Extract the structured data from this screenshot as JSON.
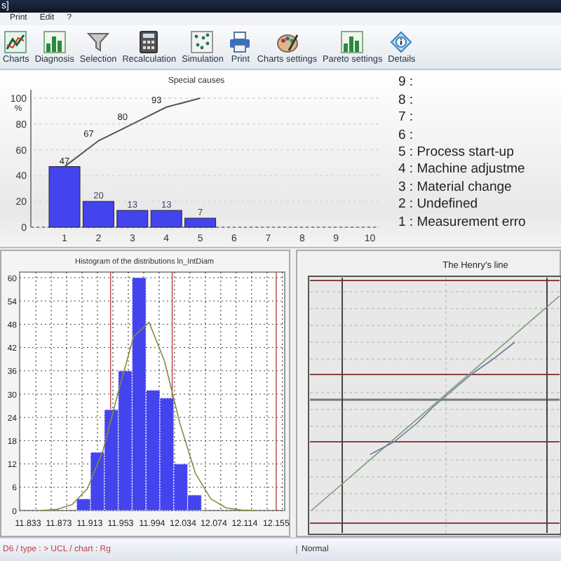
{
  "window": {
    "title": "s]"
  },
  "menu": [
    "Print",
    "Edit",
    "?"
  ],
  "toolbar": [
    {
      "label": "Charts",
      "kind": "charts"
    },
    {
      "label": "Diagnosis",
      "kind": "bars"
    },
    {
      "label": "Selection",
      "kind": "funnel"
    },
    {
      "label": "Recalculation",
      "kind": "calculator"
    },
    {
      "label": "Simulation",
      "kind": "dots"
    },
    {
      "label": "Print",
      "kind": "printer"
    },
    {
      "label": "Charts settings",
      "kind": "palette"
    },
    {
      "label": "Pareto settings",
      "kind": "bars"
    },
    {
      "label": "Details",
      "kind": "info"
    }
  ],
  "pareto": {
    "chart_data": {
      "type": "bar",
      "title": "Special causes",
      "ylabel": "%",
      "categories": [
        "1",
        "2",
        "3",
        "4",
        "5",
        "6",
        "7",
        "8",
        "9",
        "10"
      ],
      "ylim": [
        0,
        100
      ],
      "yticks": [
        0,
        20,
        40,
        60,
        80,
        100
      ],
      "grid": true,
      "series": [
        {
          "type": "bar",
          "color": "#4444ee",
          "values": [
            47,
            20,
            13,
            13,
            7,
            null,
            null,
            null,
            null,
            null
          ],
          "value_labels": [
            "47",
            "20",
            "13",
            "13",
            "7",
            null,
            null,
            null,
            null,
            null
          ]
        },
        {
          "type": "line",
          "color": "#555555",
          "values": [
            47,
            67,
            80,
            93,
            100,
            null,
            null,
            null,
            null,
            null
          ],
          "value_labels": [
            null,
            "67",
            "80",
            "93",
            null,
            null,
            null,
            null,
            null,
            null
          ]
        }
      ]
    }
  },
  "legend": [
    "9 :",
    "8 :",
    "7 :",
    "6 :",
    "5 : Process start-up",
    "4 : Machine adjustme",
    "3 : Material change",
    "2 : Undefined",
    "1 : Measurement erro"
  ],
  "histogram": {
    "chart_data": {
      "type": "bar",
      "title": "Histogram of the distributions ln_IntDiam",
      "x": [
        11.905,
        11.923,
        11.941,
        11.959,
        11.977,
        11.995,
        12.013,
        12.031,
        12.049
      ],
      "ylim": [
        0,
        60
      ],
      "yticks": [
        0,
        6,
        12,
        18,
        24,
        30,
        36,
        42,
        48,
        54,
        60
      ],
      "xlim": [
        11.822,
        12.166
      ],
      "grid": true,
      "xticks": [
        11.833,
        11.873,
        11.913,
        11.953,
        11.994,
        12.034,
        12.074,
        12.114,
        12.155
      ],
      "series": [
        {
          "type": "bar",
          "color": "#4444ee",
          "values": [
            3,
            15,
            26,
            36,
            60,
            31,
            29,
            12,
            4
          ]
        },
        {
          "type": "line",
          "color": "#8a8a40",
          "x": [
            11.85,
            11.87,
            11.89,
            11.91,
            11.93,
            11.95,
            11.97,
            11.99,
            12.01,
            12.03,
            12.05,
            12.07,
            12.09,
            12.11,
            12.13
          ],
          "values": [
            0,
            0.3,
            1.5,
            5.6,
            15.3,
            30.5,
            44.9,
            48.5,
            38.5,
            22.4,
            9.6,
            3,
            0.7,
            0.1,
            0
          ]
        }
      ],
      "ref_lines": [
        {
          "axis": "x",
          "value": 11.94,
          "color": "#bb4444"
        },
        {
          "axis": "x",
          "value": 12.02,
          "color": "#bb4444"
        },
        {
          "axis": "x",
          "value": 12.155,
          "color": "#bb4444"
        }
      ]
    }
  },
  "henry": {
    "title": "The Henry's line"
  },
  "status_bar": {
    "left": "D6 / type : > UCL / chart : Rg",
    "right": "Normal"
  }
}
